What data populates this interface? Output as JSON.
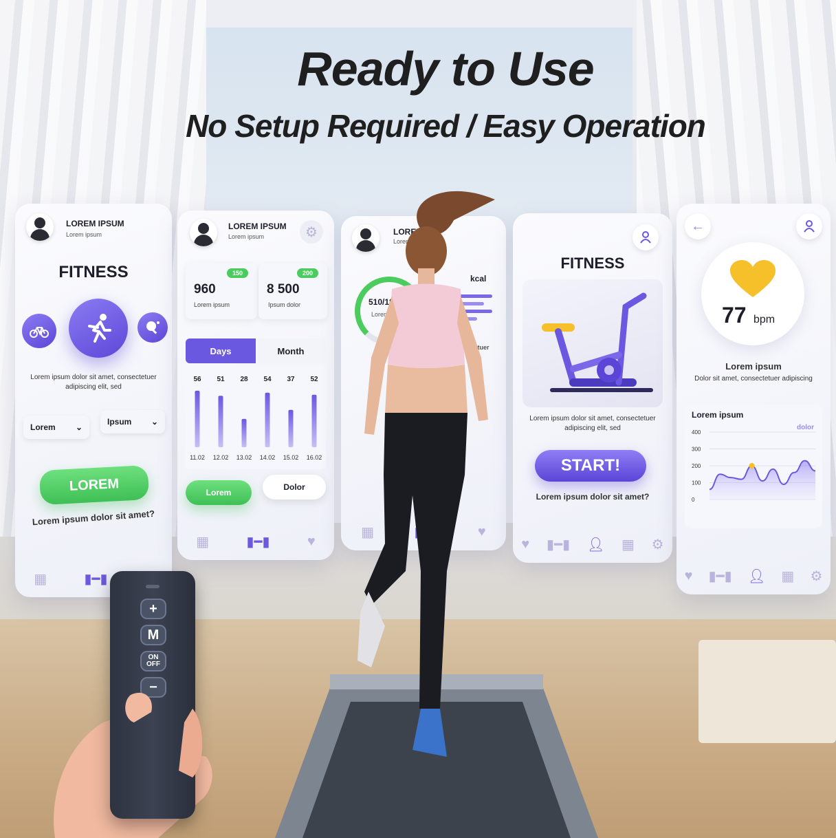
{
  "headline": {
    "title": "Ready to Use",
    "subtitle": "No Setup Required / Easy Operation"
  },
  "panel1": {
    "user_name": "LOREM IPSUM",
    "user_sub": "Lorem ipsum",
    "heading": "FITNESS",
    "desc": "Lorem ipsum dolor sit amet, consectetuer adipiscing elit, sed",
    "select1": "Lorem",
    "select2": "Ipsum",
    "cta": "LOREM",
    "caption": "Lorem ipsum dolor sit amet?"
  },
  "panel2": {
    "user_name": "LOREM IPSUM",
    "user_sub": "Lorem ipsum",
    "stat1": {
      "badge": "150",
      "value": "960",
      "label": "Lorem ipsum"
    },
    "stat2": {
      "badge": "200",
      "value": "8 500",
      "label": "Ipsum dolor"
    },
    "tab_days": "Days",
    "tab_month": "Month",
    "btn_green": "Lorem",
    "btn_white": "Dolor"
  },
  "panel3": {
    "user_name": "LOREM IP",
    "user_sub": "Lorem ip",
    "ring_value": "510/18",
    "ring_label": "Lorem ipsu",
    "kcal": "kcal",
    "kcal_note": "nctetuer"
  },
  "panel4": {
    "heading": "FITNESS",
    "desc": "Lorem ipsum dolor sit amet, consectetuer adipiscing elit, sed",
    "start": "START!",
    "caption": "Lorem ipsum dolor sit amet?"
  },
  "panel5": {
    "bpm_value": "77",
    "bpm_unit": "bpm",
    "title": "Lorem ipsum",
    "desc": "Dolor sit amet, consectetuer adipiscing",
    "chart_title": "Lorem ipsum",
    "chart_tag": "dolor"
  },
  "remote": {
    "plus": "+",
    "mode": "M",
    "on": "ON",
    "off": "OFF",
    "minus": "−"
  },
  "chart_data": [
    {
      "type": "bar",
      "categories": [
        "11.02",
        "12.02",
        "13.02",
        "14.02",
        "15.02",
        "16.02"
      ],
      "values": [
        56,
        51,
        28,
        54,
        37,
        52
      ],
      "title": "",
      "xlabel": "",
      "ylabel": ""
    },
    {
      "type": "area",
      "title": "Lorem ipsum",
      "series": [
        {
          "name": "dolor",
          "values": [
            60,
            150,
            130,
            120,
            200,
            110,
            180,
            90,
            160,
            230,
            170
          ]
        }
      ],
      "yticks": [
        0,
        100,
        200,
        300,
        400
      ],
      "ylim": [
        0,
        400
      ]
    }
  ],
  "colors": {
    "accent": "#6a58e0",
    "green": "#4ccb5e",
    "heart": "#f5c02a"
  }
}
